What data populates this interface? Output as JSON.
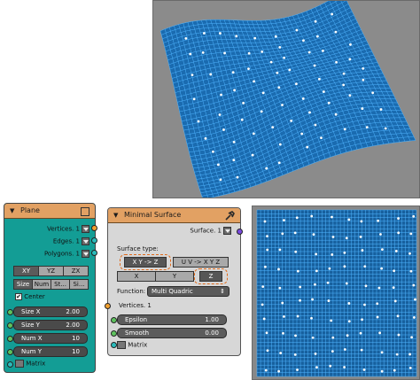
{
  "plane_node": {
    "title": "Plane",
    "outputs": [
      "Vertices. 1",
      "Edges. 1",
      "Polygons. 1"
    ],
    "direction_tabs": [
      "XY",
      "YZ",
      "ZX"
    ],
    "mode_tabs": [
      "Size",
      "Num",
      "St...",
      "Si..."
    ],
    "center_label": "Center",
    "center_checked": true,
    "fields": [
      {
        "label": "Size X",
        "value": "2.00"
      },
      {
        "label": "Size Y",
        "value": "2.00"
      },
      {
        "label": "Num X",
        "value": "10"
      },
      {
        "label": "Num Y",
        "value": "10"
      }
    ],
    "matrix_label": "Matrix"
  },
  "minimal_surface_node": {
    "title": "Minimal Surface",
    "output_label": "Surface. 1",
    "surface_type_label": "Surface type:",
    "surface_types": [
      "X Y -> Z",
      "U V -> X Y Z"
    ],
    "axes": [
      "X",
      "Y",
      "Z"
    ],
    "function_label": "Function:",
    "function_value": "Multi Quadric",
    "inputs": {
      "vertices": "Vertices. 1",
      "matrix": "Matrix"
    },
    "fields": [
      {
        "label": "Epsilon",
        "value": "1.00"
      },
      {
        "label": "Smooth",
        "value": "0.00"
      }
    ]
  },
  "colors": {
    "node_header": "#e2a163",
    "plane_body": "#139d95",
    "mesh_blue": "#1f8ad8",
    "viewport_bg": "#8b8b8b",
    "highlight_ring": "#e06a1a"
  }
}
